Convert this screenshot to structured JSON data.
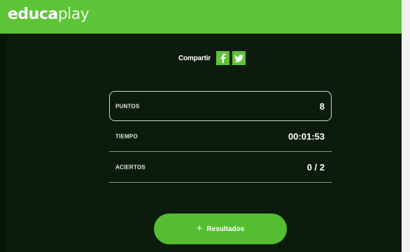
{
  "brand": {
    "logo_bold": "educa",
    "logo_light": "play"
  },
  "share": {
    "label": "Compartir",
    "icons": [
      "facebook-icon",
      "twitter-icon"
    ]
  },
  "stats": [
    {
      "label": "PUNTOS",
      "value": "8"
    },
    {
      "label": "TIEMPO",
      "value": "00:01:53"
    },
    {
      "label": "ACIERTOS",
      "value": "0 / 2"
    }
  ],
  "results_button": {
    "icon": "plus-icon",
    "label": "Resultados"
  },
  "colors": {
    "brand_green": "#5dc337",
    "panel_bg": "#0c1c0c"
  }
}
